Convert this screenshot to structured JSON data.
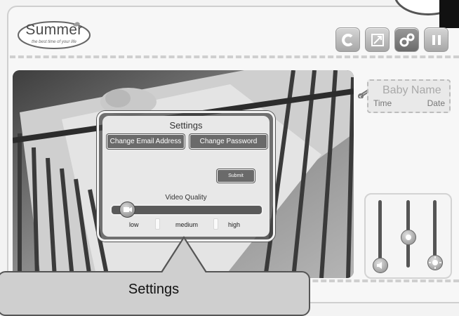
{
  "logo": {
    "name": "Summer",
    "tagline": "the best time of your life"
  },
  "toolbar": {
    "buttons": [
      "refresh",
      "fullscreen",
      "settings",
      "power"
    ]
  },
  "name_tag": {
    "title": "Baby Name",
    "time_label": "Time",
    "date_label": "Date"
  },
  "settings_popup": {
    "title": "Settings",
    "change_email_label": "Change Email Address",
    "change_password_label": "Change Password",
    "submit_label": "Submit",
    "video_quality_label": "Video Quality",
    "quality_options": [
      "low",
      "medium",
      "high"
    ],
    "selected_quality": "low"
  },
  "callout": {
    "title": "Settings"
  },
  "icons": {
    "refresh": "refresh-icon",
    "fullscreen": "expand-icon",
    "settings": "gears-icon",
    "power": "power-icon",
    "pin": "safety-pin-icon",
    "volume": "speaker-icon",
    "brightness": "sun-icon",
    "camera": "camera-icon"
  },
  "colors": {
    "button_dark": "#6a6a6a",
    "background": "#f3f3f3"
  }
}
